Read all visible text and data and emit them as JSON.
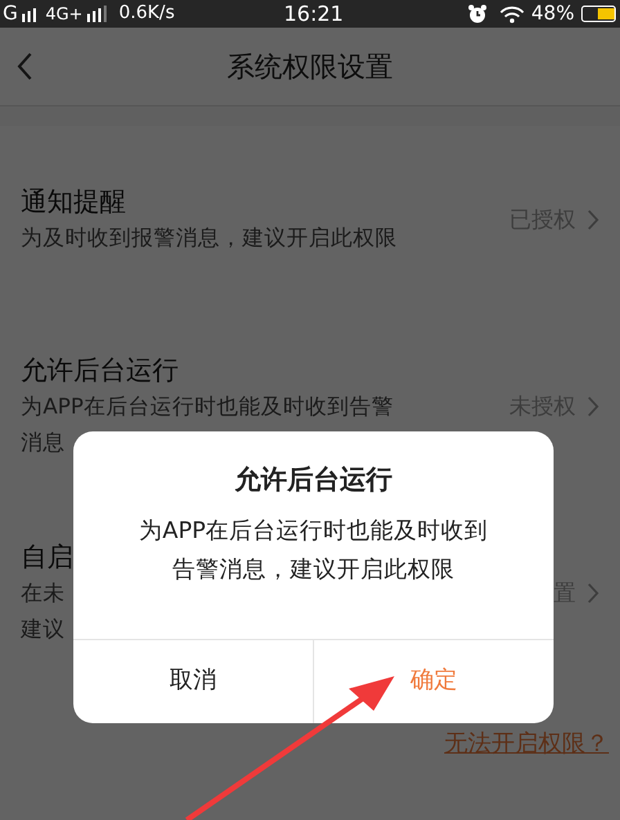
{
  "status_bar": {
    "network_1": "G",
    "network_2": "4G+",
    "speed": "0.6K/s",
    "time": "16:21",
    "battery": "48%"
  },
  "nav": {
    "title": "系统权限设置"
  },
  "permissions": [
    {
      "title": "通知提醒",
      "description_lines": [
        "为及时收到报警消息，建议开启此权限"
      ],
      "status": "已授权"
    },
    {
      "title": "允许后台运行",
      "description_lines": [
        "为APP在后台运行时也能及时收到告警",
        "消息"
      ],
      "status": "未授权"
    },
    {
      "title": "自启",
      "description_lines": [
        "在未",
        "建议"
      ],
      "status": "置"
    }
  ],
  "help_link": "无法开启权限？",
  "dialog": {
    "title": "允许后台运行",
    "message_lines": [
      "为APP在后台运行时也能及时收到",
      "告警消息，建议开启此权限"
    ],
    "buttons": [
      {
        "label": "取消",
        "kind": "cancel"
      },
      {
        "label": "确定",
        "kind": "confirm"
      }
    ]
  }
}
